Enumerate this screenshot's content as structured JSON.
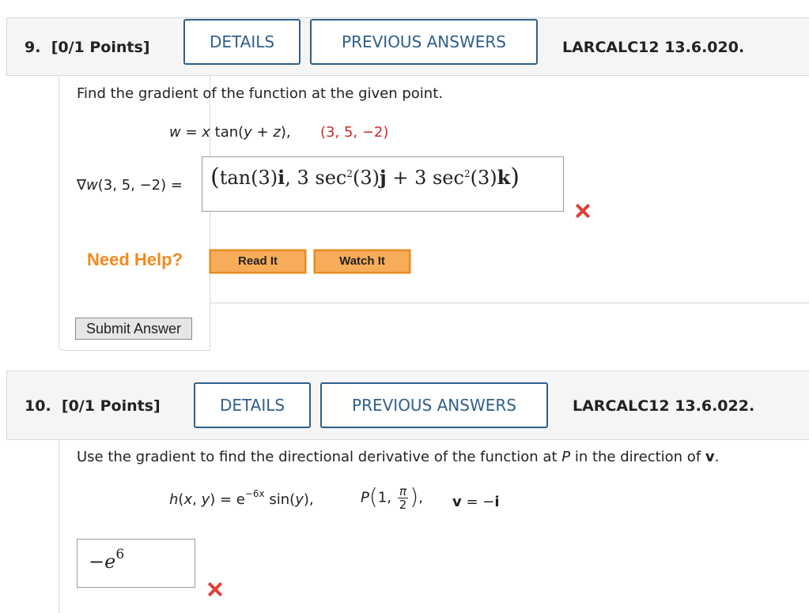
{
  "q9": {
    "number": "9.",
    "points": "[0/1 Points]",
    "details_label": "DETAILS",
    "previous_label": "PREVIOUS ANSWERS",
    "reference": "LARCALC12 13.6.020.",
    "prompt": "Find the gradient of the function at the given point.",
    "function_lhs": "w",
    "function_eq": " = ",
    "function_x": "x",
    "function_tan": " tan(",
    "function_y": "y",
    "function_plus": " + ",
    "function_z": "z",
    "function_close": "),",
    "point": "(3, 5, −2)",
    "gradient_nabla": "∇",
    "gradient_w": "w",
    "gradient_rest": "(3, 5, −2)  =",
    "answer_part1": "tan(3)",
    "answer_i": "i",
    "answer_part2": ", 3 sec",
    "answer_sup1": "2",
    "answer_part3": "(3)",
    "answer_j": "j",
    "answer_part4": " + 3 sec",
    "answer_sup2": "2",
    "answer_part5": "(3)",
    "answer_k": "k",
    "help_label": "Need Help?",
    "read_it": "Read It",
    "watch_it": "Watch It",
    "submit_label": "Submit Answer"
  },
  "q10": {
    "number": "10.",
    "points": "[0/1 Points]",
    "details_label": "DETAILS",
    "previous_label": "PREVIOUS ANSWERS",
    "reference": "LARCALC12 13.6.022.",
    "prompt_a": "Use the gradient to find the directional derivative of the function at ",
    "prompt_p": "P",
    "prompt_b": " in the direction of ",
    "prompt_v": "v",
    "prompt_c": ".",
    "h_name": "h",
    "h_args_open": "(",
    "h_x": "x",
    "h_comma": ", ",
    "h_y": "y",
    "h_args_close": ") = ",
    "h_e": "e",
    "h_exp": "−6x",
    "h_sin": " sin(",
    "h_sin_y": "y",
    "h_sin_close": "),",
    "p_label": "P",
    "p_first": "1, ",
    "p_num": "π",
    "p_den": "2",
    "p_close": ",",
    "v_label": "v",
    "v_eq": " = −",
    "v_i": "i",
    "answer_base": "−e",
    "answer_exp": "6"
  }
}
